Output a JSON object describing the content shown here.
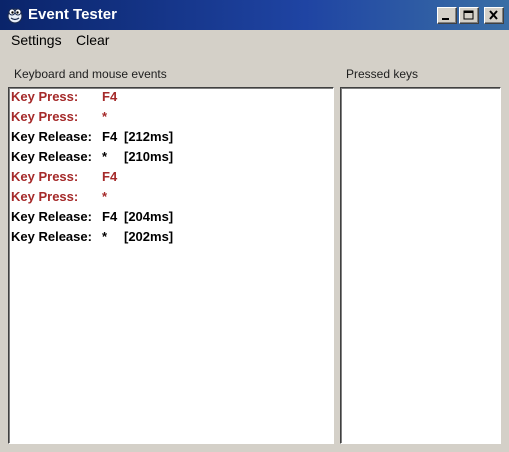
{
  "window": {
    "title": "Event Tester",
    "icon": "app-icon"
  },
  "menu": {
    "settings": "Settings",
    "clear": "Clear"
  },
  "labels": {
    "events": "Keyboard and mouse events",
    "pressed": "Pressed keys"
  },
  "colors": {
    "press": "#a52a2a",
    "release": "#000000",
    "titlebar": "#0a246a"
  },
  "events": [
    {
      "type": "press",
      "label": "Key Press:",
      "key": "F4",
      "time": ""
    },
    {
      "type": "press",
      "label": "Key Press:",
      "key": "*",
      "time": ""
    },
    {
      "type": "release",
      "label": "Key Release:",
      "key": "F4",
      "time": "[212ms]"
    },
    {
      "type": "release",
      "label": "Key Release:",
      "key": "*",
      "time": "[210ms]"
    },
    {
      "type": "press",
      "label": "Key Press:",
      "key": "F4",
      "time": ""
    },
    {
      "type": "press",
      "label": "Key Press:",
      "key": "*",
      "time": ""
    },
    {
      "type": "release",
      "label": "Key Release:",
      "key": "F4",
      "time": "[204ms]"
    },
    {
      "type": "release",
      "label": "Key Release:",
      "key": "*",
      "time": "[202ms]"
    }
  ],
  "pressed_keys": []
}
